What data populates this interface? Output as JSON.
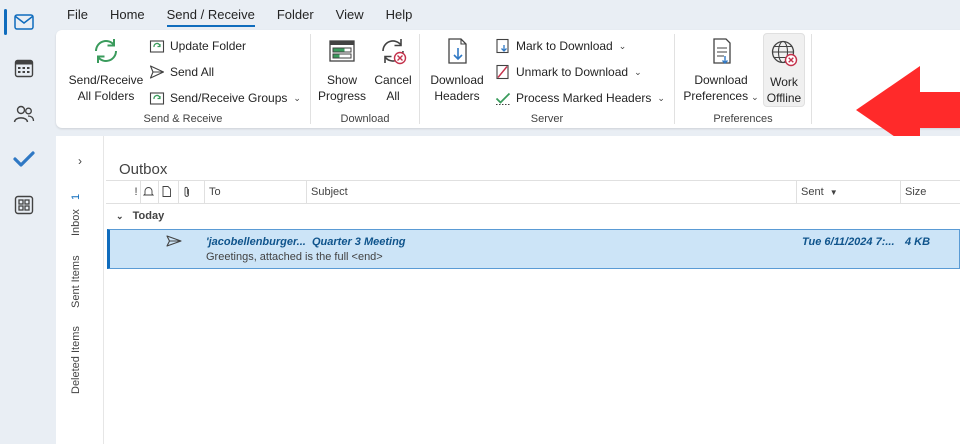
{
  "menu": {
    "file": "File",
    "home": "Home",
    "send_receive": "Send / Receive",
    "folder": "Folder",
    "view": "View",
    "help": "Help"
  },
  "ribbon": {
    "send_receive_group": {
      "label": "Send & Receive",
      "send_receive_all_line1": "Send/Receive",
      "send_receive_all_line2": "All Folders",
      "update_folder": "Update Folder",
      "send_all": "Send All",
      "send_receive_groups": "Send/Receive Groups"
    },
    "download_group": {
      "label": "Download",
      "show_progress_line1": "Show",
      "show_progress_line2": "Progress",
      "cancel_all_line1": "Cancel",
      "cancel_all_line2": "All"
    },
    "server_group": {
      "label": "Server",
      "download_headers_line1": "Download",
      "download_headers_line2": "Headers",
      "mark_to_download": "Mark to Download",
      "unmark_to_download": "Unmark to Download",
      "process_marked_headers": "Process Marked Headers"
    },
    "preferences_group": {
      "label": "Preferences",
      "download_preferences_line1": "Download",
      "download_preferences_line2": "Preferences",
      "work_offline_line1": "Work",
      "work_offline_line2": "Offline"
    }
  },
  "folder_pane": {
    "inbox": "Inbox",
    "inbox_count": "1",
    "sent_items": "Sent Items",
    "deleted_items": "Deleted Items"
  },
  "list": {
    "folder_title": "Outbox",
    "columns": {
      "importance": "!",
      "to": "To",
      "subject": "Subject",
      "sent": "Sent",
      "size": "Size"
    },
    "group_today": "Today",
    "message": {
      "to": "'jacobellenburger...",
      "subject": "Quarter 3 Meeting",
      "sent": "Tue 6/11/2024 7:...",
      "size": "4 KB",
      "preview": "Greetings, attached is the full <end>"
    }
  },
  "colors": {
    "accent": "#0f6cbd",
    "selection": "#cce4f7",
    "arrow": "#ff2a2a"
  }
}
